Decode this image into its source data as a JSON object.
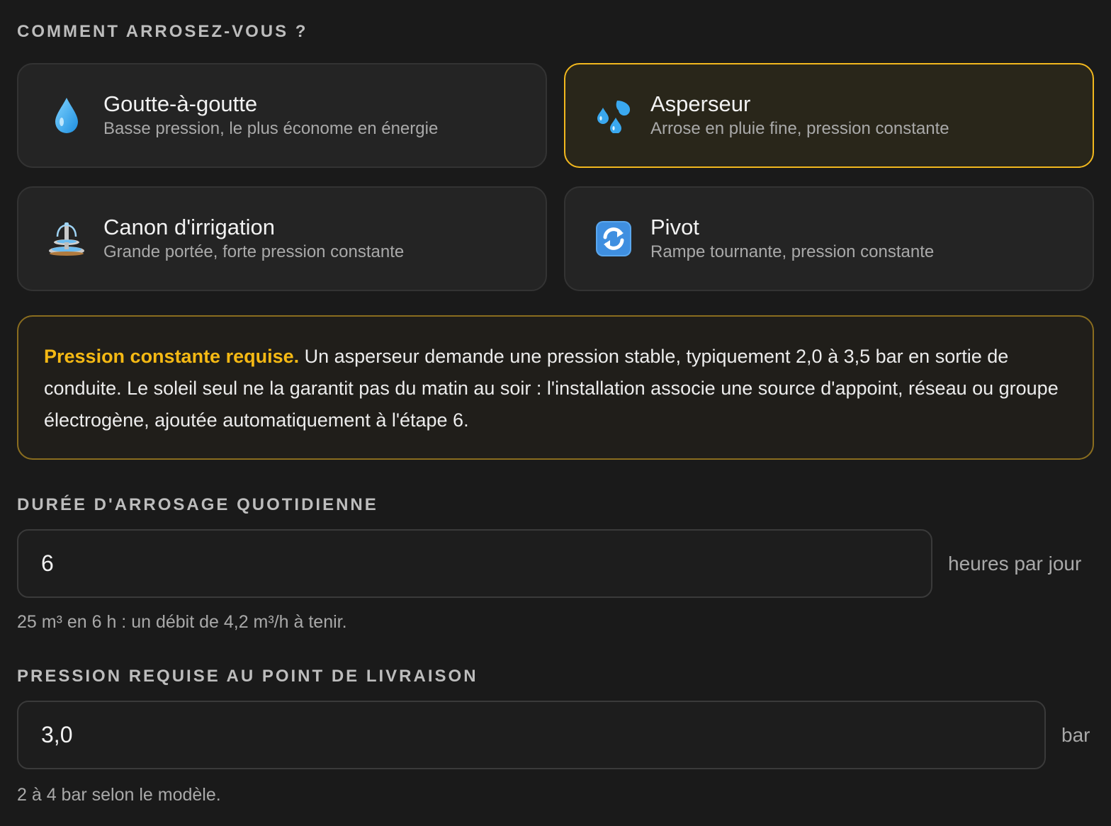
{
  "question_label": "COMMENT ARROSEZ-VOUS ?",
  "methods": [
    {
      "title": "Goutte-à-goutte",
      "desc": "Basse pression, le plus économe en énergie",
      "icon": "droplet-icon",
      "selected": false
    },
    {
      "title": "Asperseur",
      "desc": "Arrose en pluie fine, pression constante",
      "icon": "sweat-droplets-icon",
      "selected": true
    },
    {
      "title": "Canon d'irrigation",
      "desc": "Grande portée, forte pression constante",
      "icon": "fountain-icon",
      "selected": false
    },
    {
      "title": "Pivot",
      "desc": "Rampe tournante, pression constante",
      "icon": "rotate-arrows-icon",
      "selected": false
    }
  ],
  "notice": {
    "strong": "Pression constante requise.",
    "text": " Un asperseur demande une pression stable, typiquement 2,0 à 3,5 bar en sortie de conduite. Le soleil seul ne la garantit pas du matin au soir : l'installation associe une source d'appoint, réseau ou groupe électrogène, ajoutée automatiquement à l'étape 6."
  },
  "duration": {
    "label": "DURÉE D'ARROSAGE QUOTIDIENNE",
    "value": "6",
    "unit": "heures par jour",
    "hint": "25 m³ en 6 h : un débit de 4,2 m³/h à tenir."
  },
  "pressure": {
    "label": "PRESSION REQUISE AU POINT DE LIVRAISON",
    "value": "3,0",
    "unit": "bar",
    "hint": "2 à 4 bar selon le modèle."
  },
  "colors": {
    "accent": "#f2b81e",
    "background": "#1a1a1a",
    "card": "#242424",
    "selected_card": "#29261a"
  }
}
